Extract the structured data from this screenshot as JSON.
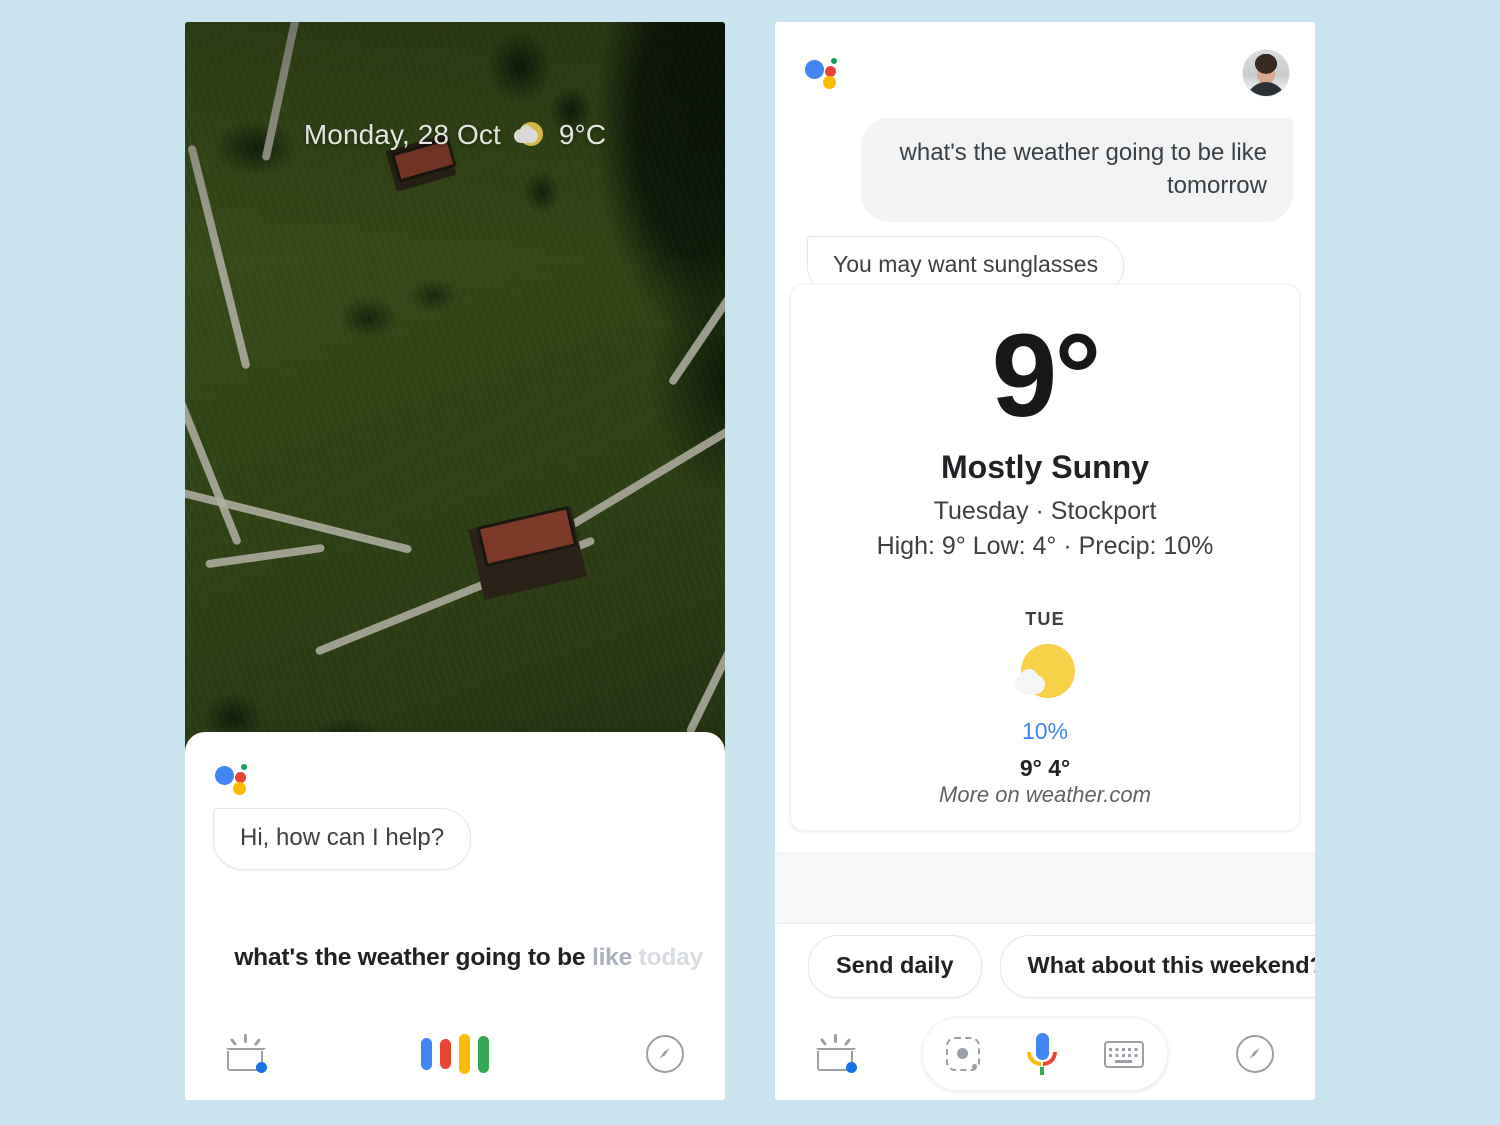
{
  "background_color": "#C9E4EE",
  "left_phone": {
    "ambient": {
      "date": "Monday, 28 Oct",
      "temperature": "9°C",
      "weather_icon": "partly-cloudy-sun-icon",
      "photo_description": "aerial-landscape-photo"
    },
    "assistant_logo": "google-assistant-logo",
    "greeting_bubble": "Hi, how can I help?",
    "transcript": {
      "confirmed": "what's the weather going to be",
      "partial": "like",
      "tentative": "today"
    },
    "navbar": {
      "snapshot_icon": "snapshot-inbox-icon",
      "listening_indicator": "assistant-listening-bars",
      "explore_icon": "compass-explore-icon"
    }
  },
  "right_phone": {
    "assistant_logo": "google-assistant-logo",
    "avatar": "user-avatar-photo",
    "user_message": "what's the weather going to be like tomorrow",
    "assistant_reply": "You may want sunglasses",
    "weather_card": {
      "temperature": "9°",
      "condition": "Mostly Sunny",
      "day_location": "Tuesday · Stockport",
      "details": "High: 9° Low: 4° · Precip: 10%",
      "forecast": {
        "day_label": "TUE",
        "icon": "mostly-sunny-icon",
        "precip": "10%",
        "precip_color": "#4285F4",
        "high_low": "9° 4°"
      },
      "attribution": "More on weather.com"
    },
    "chips": [
      {
        "label": "Send daily"
      },
      {
        "label": "What about this weekend?"
      },
      {
        "label": ""
      }
    ],
    "navbar": {
      "snapshot_icon": "snapshot-inbox-icon",
      "lens_icon": "google-lens-icon",
      "mic_icon": "google-mic-icon",
      "keyboard_icon": "keyboard-icon",
      "explore_icon": "compass-explore-icon"
    }
  }
}
